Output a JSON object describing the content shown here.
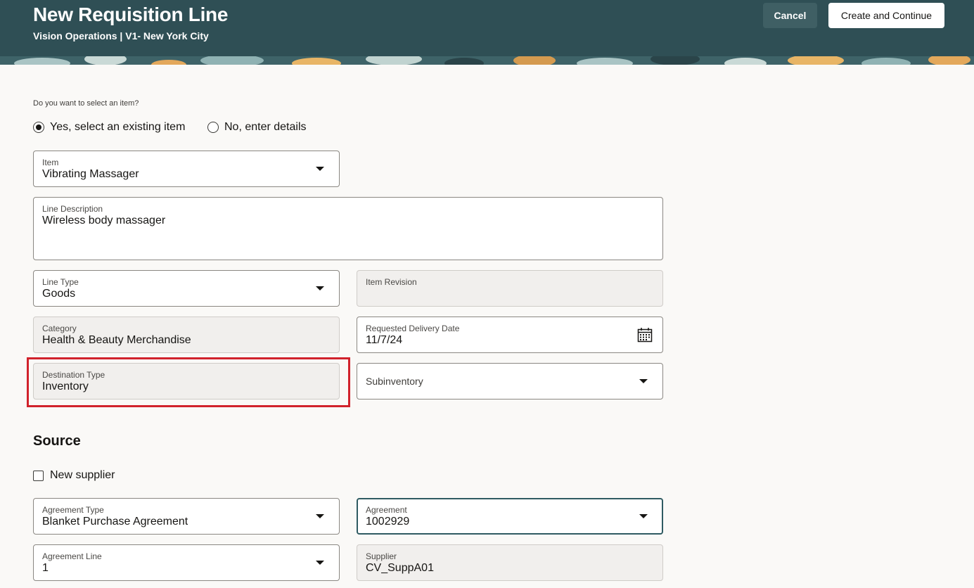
{
  "header": {
    "title": "New Requisition Line",
    "subtitle": "Vision Operations | V1- New York City",
    "cancel_label": "Cancel",
    "create_label": "Create and Continue"
  },
  "item_selection": {
    "question": "Do you want to select an item?",
    "options": [
      {
        "label": "Yes, select an existing item",
        "selected": true
      },
      {
        "label": "No, enter details",
        "selected": false
      }
    ]
  },
  "fields": {
    "item": {
      "label": "Item",
      "value": "Vibrating Massager"
    },
    "line_description": {
      "label": "Line Description",
      "value": "Wireless body massager"
    },
    "line_type": {
      "label": "Line Type",
      "value": "Goods"
    },
    "item_revision": {
      "label": "Item Revision",
      "value": ""
    },
    "category": {
      "label": "Category",
      "value": "Health & Beauty Merchandise"
    },
    "requested_delivery_date": {
      "label": "Requested Delivery Date",
      "value": "11/7/24"
    },
    "destination_type": {
      "label": "Destination Type",
      "value": "Inventory"
    },
    "subinventory": {
      "label": "Subinventory",
      "value": ""
    }
  },
  "source": {
    "title": "Source",
    "new_supplier_label": "New supplier",
    "new_supplier_checked": false,
    "agreement_type": {
      "label": "Agreement Type",
      "value": "Blanket Purchase Agreement"
    },
    "agreement": {
      "label": "Agreement",
      "value": "1002929"
    },
    "agreement_line": {
      "label": "Agreement Line",
      "value": "1"
    },
    "supplier": {
      "label": "Supplier",
      "value": "CV_SuppA01"
    }
  },
  "colors": {
    "header_bg": "#2f4f55",
    "highlight": "#d1222c",
    "focus_border": "#2f5b62"
  },
  "icons": {
    "dropdown": "chevron-down-icon",
    "calendar": "calendar-icon"
  }
}
